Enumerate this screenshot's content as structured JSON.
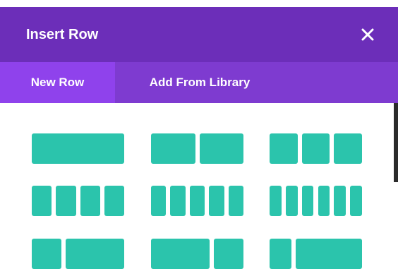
{
  "dialog": {
    "title": "Insert Row",
    "close_icon": "close-icon"
  },
  "tabs": [
    {
      "label": "New Row",
      "active": true
    },
    {
      "label": "Add From Library",
      "active": false
    }
  ],
  "colors": {
    "header_bg": "#6c2eb9",
    "tabbar_bg": "#7e3bd0",
    "active_tab_bg": "#8f42ec",
    "column_block": "#2bc4ac"
  },
  "row_layouts": [
    {
      "name": "one-column",
      "columns": [
        1
      ]
    },
    {
      "name": "two-columns",
      "columns": [
        1,
        1
      ]
    },
    {
      "name": "three-columns",
      "columns": [
        1,
        1,
        1
      ]
    },
    {
      "name": "four-columns",
      "columns": [
        1,
        1,
        1,
        1
      ]
    },
    {
      "name": "five-columns",
      "columns": [
        1,
        1,
        1,
        1,
        1
      ]
    },
    {
      "name": "six-columns",
      "columns": [
        1,
        1,
        1,
        1,
        1,
        1
      ]
    },
    {
      "name": "one-third-two-thirds",
      "columns": [
        1,
        2
      ]
    },
    {
      "name": "two-thirds-one-third",
      "columns": [
        2,
        1
      ]
    },
    {
      "name": "one-quarter-three-quarters",
      "columns": [
        1,
        3
      ]
    }
  ]
}
